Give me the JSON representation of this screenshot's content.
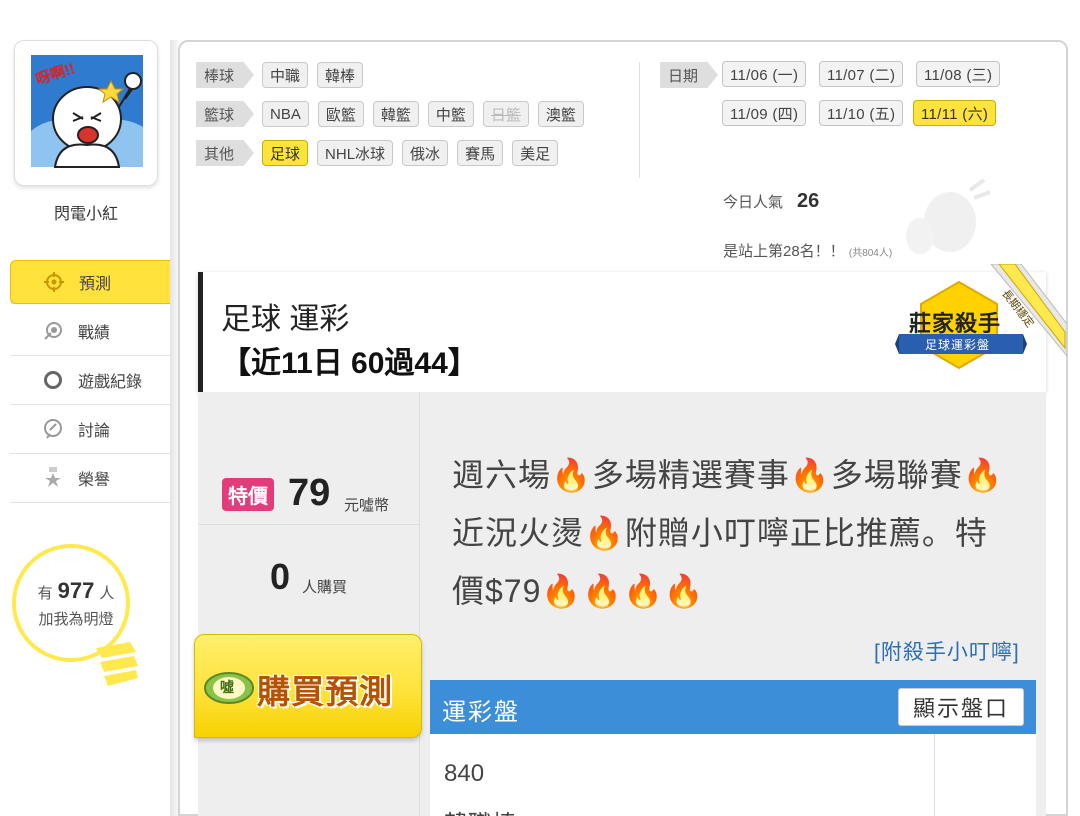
{
  "sidebar": {
    "avatar_text": "呀啊!!",
    "username": "閃電小紅",
    "menu": [
      {
        "label": "預測",
        "icon": "target-icon",
        "active": true
      },
      {
        "label": "戰績",
        "icon": "medal-icon",
        "active": false
      },
      {
        "label": "遊戲紀錄",
        "icon": "ring-icon",
        "active": false
      },
      {
        "label": "討論",
        "icon": "chat-icon",
        "active": false
      },
      {
        "label": "榮譽",
        "icon": "trophy-icon",
        "active": false
      }
    ],
    "lamp": {
      "prefix": "有",
      "count": "977",
      "suffix": "人",
      "caption": "加我為明燈"
    }
  },
  "filters": {
    "baseball": {
      "label": "棒球",
      "items": [
        "中職",
        "韓棒"
      ]
    },
    "basketball": {
      "label": "籃球",
      "items": [
        "NBA",
        "歐籃",
        "韓籃",
        "中籃",
        "日籃",
        "澳籃"
      ]
    },
    "other": {
      "label": "其他",
      "items": [
        "足球",
        "NHL冰球",
        "俄冰",
        "賽馬",
        "美足"
      ]
    },
    "selected_sport": "足球",
    "disabled": "日籃"
  },
  "dates": {
    "label": "日期",
    "items": [
      "11/06 (一)",
      "11/07 (二)",
      "11/08 (三)",
      "11/09 (四)",
      "11/10 (五)",
      "11/11 (六)"
    ],
    "selected": "11/11 (六)"
  },
  "stats": {
    "popularity_label": "今日人氣",
    "popularity_value": "26",
    "rank_text": "是站上第28名！！",
    "rank_total": "(共804人)"
  },
  "prediction": {
    "title_line1": "足球 運彩",
    "title_line2": "【近11日 60過44】",
    "badge_main": "莊家殺手",
    "badge_sub": "足球運彩盤",
    "badge_ribbon": "長期穩定",
    "special_label": "特價",
    "price": "79",
    "price_unit": "元噓幣",
    "buyers": "0",
    "buyers_unit": "人購買",
    "buy_button": "購買預測",
    "buy_icon_text": "噓",
    "description": "週六場🔥多場精選賽事🔥多場聯賽🔥近況火燙🔥附贈小叮嚀正比推薦。特價$79🔥🔥🔥🔥",
    "attach_link": "[附殺手小叮嚀]",
    "lottery_title": "運彩盤",
    "show_button": "顯示盤口",
    "game_number": "840",
    "next_line": "韓職棒"
  },
  "colors": {
    "accent_yellow": "#ffe23c",
    "accent_blue": "#3d8ed8",
    "special_pink": "#e33c7d",
    "link_blue": "#2a6fb8"
  }
}
